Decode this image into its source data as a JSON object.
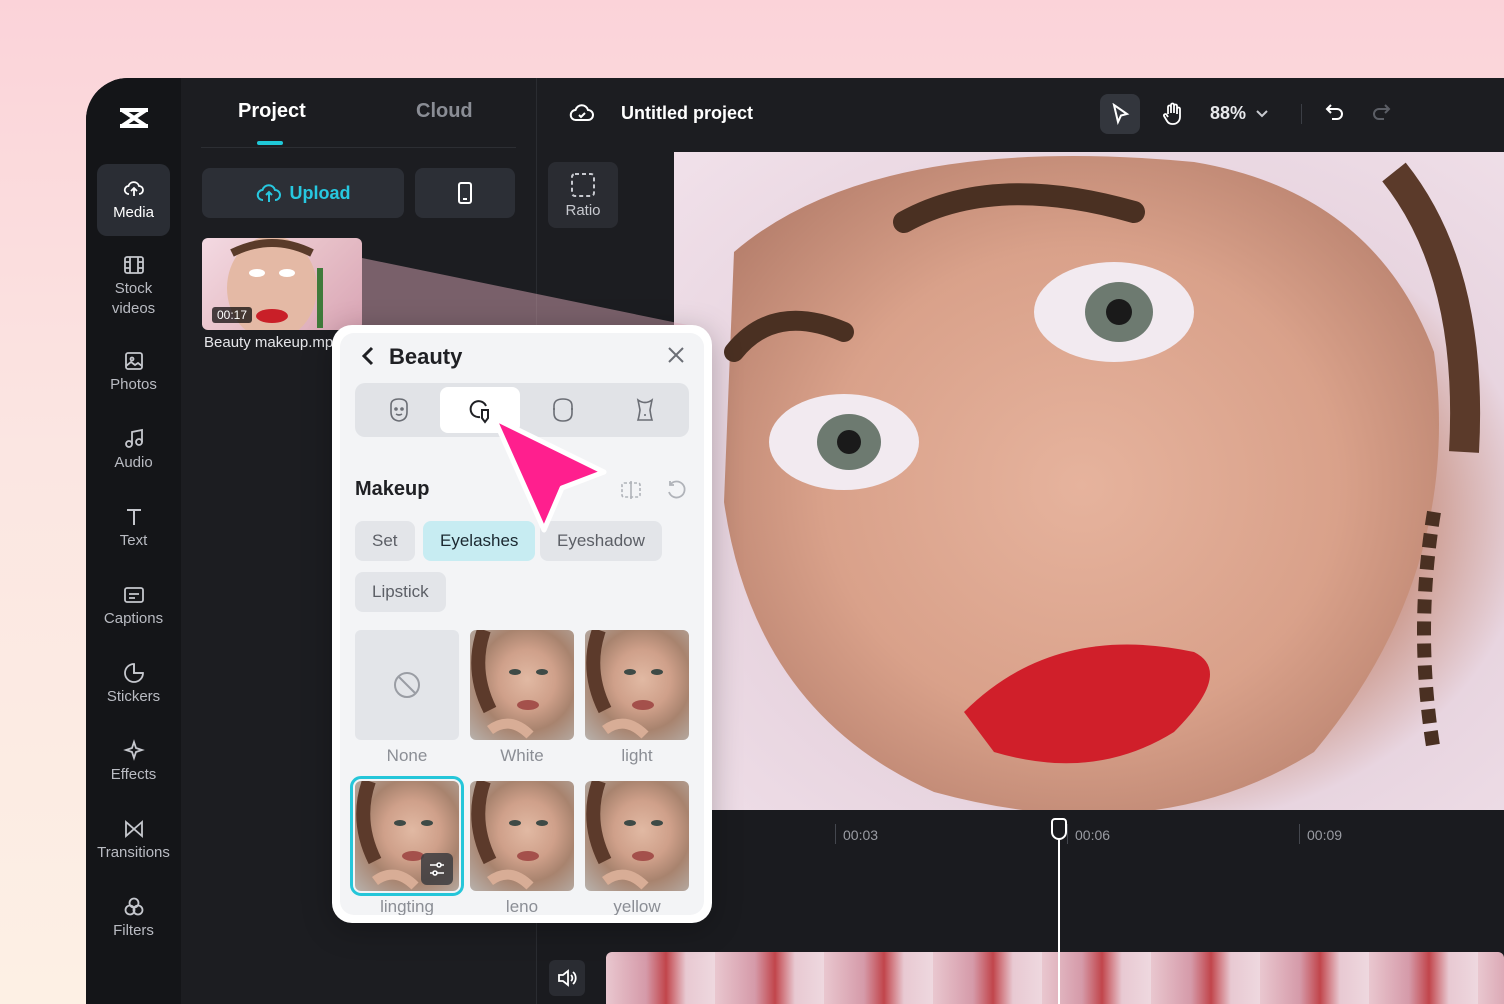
{
  "sidebar": {
    "items": [
      {
        "label": "Media",
        "icon": "cloud-upload-icon",
        "active": true
      },
      {
        "label": "Stock\nvideos",
        "icon": "film-icon"
      },
      {
        "label": "Photos",
        "icon": "image-icon"
      },
      {
        "label": "Audio",
        "icon": "music-note-icon"
      },
      {
        "label": "Text",
        "icon": "text-icon"
      },
      {
        "label": "Captions",
        "icon": "captions-icon"
      },
      {
        "label": "Stickers",
        "icon": "sticker-icon"
      },
      {
        "label": "Effects",
        "icon": "sparkle-icon"
      },
      {
        "label": "Transitions",
        "icon": "transition-icon"
      },
      {
        "label": "Filters",
        "icon": "filter-icon"
      }
    ]
  },
  "media_panel": {
    "tabs": [
      "Project",
      "Cloud"
    ],
    "upload_label": "Upload",
    "clip": {
      "duration": "00:17",
      "name": "Beauty makeup.mp"
    }
  },
  "topbar": {
    "project_title": "Untitled project",
    "zoom": "88%"
  },
  "ratio_label": "Ratio",
  "timeline": {
    "ticks": [
      "00:03",
      "00:06",
      "00:09"
    ]
  },
  "beauty_panel": {
    "title": "Beauty",
    "section": "Makeup",
    "categories": [
      "Set",
      "Eyelashes",
      "Eyeshadow",
      "Lipstick"
    ],
    "active_category": "Eyelashes",
    "presets": [
      "None",
      "White",
      "light",
      "lingting",
      "leno",
      "yellow"
    ],
    "selected_preset": "lingting"
  },
  "colors": {
    "accent": "#1fc8d8",
    "pointer": "#ff1f8e",
    "app_bg": "#1c1d21"
  }
}
